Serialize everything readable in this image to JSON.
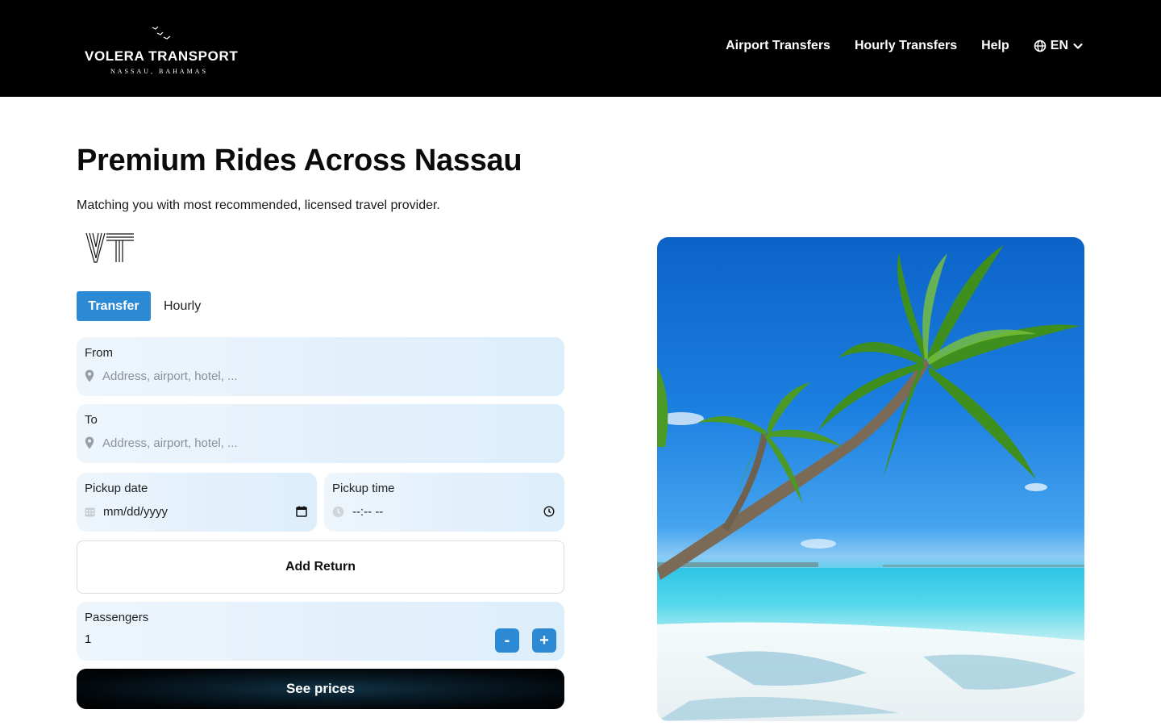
{
  "header": {
    "brand": "VOLERA TRANSPORT",
    "tagline": "NASSAU, BAHAMAS",
    "nav": [
      {
        "label": "Airport Transfers"
      },
      {
        "label": "Hourly Transfers"
      },
      {
        "label": "Help"
      }
    ],
    "language": {
      "label": "EN",
      "icon": "globe-icon"
    }
  },
  "hero": {
    "title": "Premium Rides Across Nassau",
    "subtitle": "Matching you with most recommended, licensed travel provider.",
    "logo_text": "VT"
  },
  "tabs": {
    "transfer": "Transfer",
    "hourly": "Hourly",
    "active": "Transfer"
  },
  "form": {
    "from": {
      "label": "From",
      "placeholder": "Address, airport, hotel, ..."
    },
    "to": {
      "label": "To",
      "placeholder": "Address, airport, hotel, ..."
    },
    "pickup_date": {
      "label": "Pickup date",
      "value": "mm/dd/yyyy"
    },
    "pickup_time": {
      "label": "Pickup time",
      "value": "--:-- --"
    },
    "add_return": "Add Return",
    "passengers": {
      "label": "Passengers",
      "value": "1",
      "minus": "-",
      "plus": "+"
    },
    "submit": "See prices"
  },
  "colors": {
    "accent": "#2b8ad3",
    "header_bg": "#000000",
    "field_bg": "#e3f0fb"
  }
}
